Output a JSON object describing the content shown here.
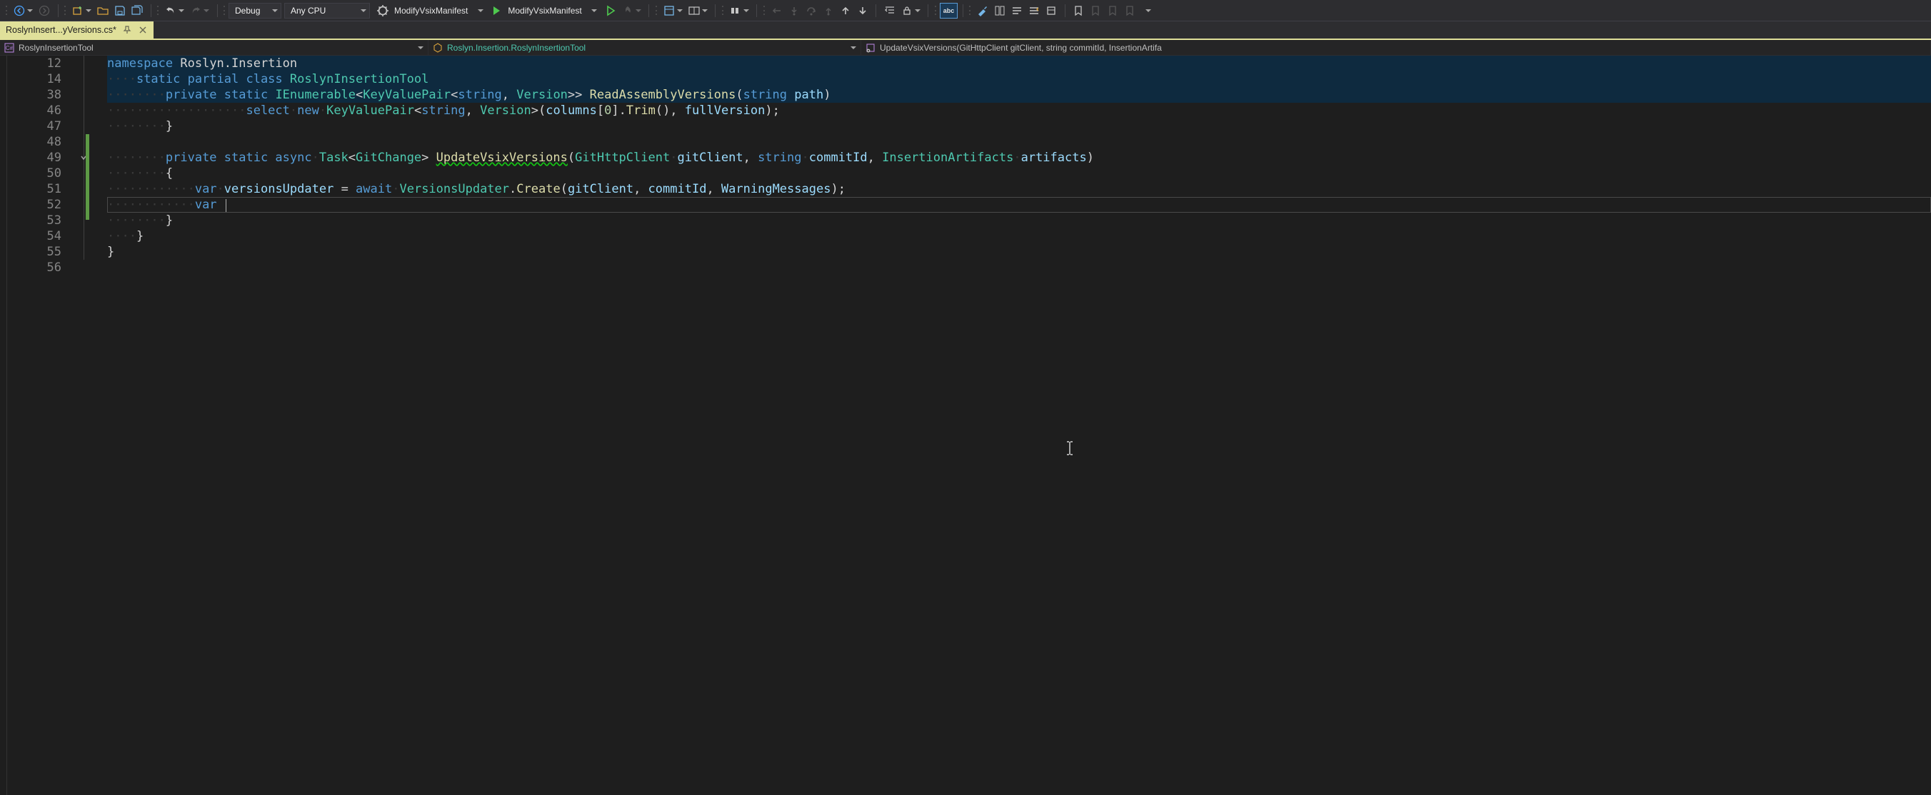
{
  "toolbar": {
    "config_combo": "Debug",
    "platform_combo": "Any CPU",
    "startup1": "ModifyVsixManifest",
    "startup2": "ModifyVsixManifest"
  },
  "tab": {
    "title": "RoslynInsert...yVersions.cs*"
  },
  "nav": {
    "project": "RoslynInsertionTool",
    "type": "Roslyn.Insertion.RoslynInsertionTool",
    "member": "UpdateVsixVersions(GitHttpClient gitClient, string commitId, InsertionArtifa"
  },
  "lines": {
    "nums": [
      "12",
      "14",
      "38",
      "46",
      "47",
      "48",
      "49",
      "50",
      "51",
      "52",
      "53",
      "54",
      "55",
      "56"
    ]
  },
  "code": {
    "l12": {
      "ns": "namespace",
      "name": "Roslyn.Insertion"
    },
    "l14": {
      "mods": "static partial class",
      "name": "RoslynInsertionTool"
    },
    "l38": {
      "mods": "private static",
      "ret": "IEnumerable",
      "kvp": "KeyValuePair",
      "str": "string",
      "ver": "Version",
      "fn": "ReadAssemblyVersions",
      "p1t": "string",
      "p1n": "path"
    },
    "l46": {
      "sel": "select",
      "new": "new",
      "kvp": "KeyValuePair",
      "str": "string",
      "ver": "Version",
      "cols": "columns",
      "idx": "0",
      "trim": "Trim",
      "fv": "fullVersion"
    },
    "l47": {
      "br": "}"
    },
    "l49": {
      "mods": "private static async",
      "task": "Task",
      "gc": "GitChange",
      "fn": "UpdateVsixVersions",
      "p1t": "GitHttpClient",
      "p1n": "gitClient",
      "p2t": "string",
      "p2n": "commitId",
      "p3t": "InsertionArtifacts",
      "p3n": "artifacts"
    },
    "l50": {
      "br": "{"
    },
    "l51": {
      "var": "var",
      "name": "versionsUpdater",
      "await": "await",
      "cls": "VersionsUpdater",
      "create": "Create",
      "a1": "gitClient",
      "a2": "commitId",
      "a3": "WarningMessages"
    },
    "l52": {
      "var": "var"
    },
    "l53": {
      "br": "}"
    },
    "l54": {
      "br": "}"
    },
    "l55": {
      "br": "}"
    }
  }
}
